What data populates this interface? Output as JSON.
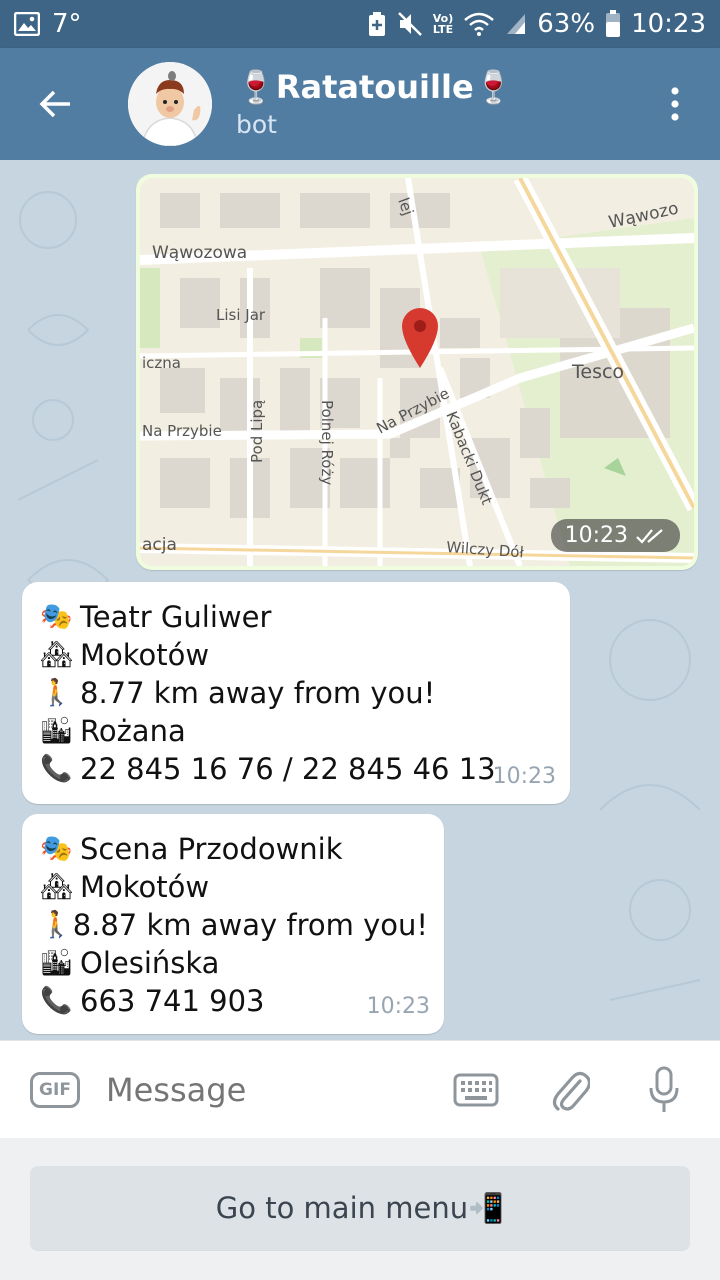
{
  "status_bar": {
    "temperature": "7°",
    "volte_label": "Vo)\nLTE",
    "battery": "63%",
    "time": "10:23"
  },
  "header": {
    "title": "🍷Ratatouille🍷",
    "subtitle": "bot"
  },
  "map_message": {
    "time": "10:23",
    "streets": {
      "s1": "Wąwozowa",
      "s2": "Wąwozo",
      "s3": "Lisi Jar",
      "s4": "iczna",
      "s5": "Tesco",
      "s6": "Na Przybie",
      "s7": "Na Przybie",
      "s8": "Pod Lipą",
      "s9": "Polnej Róży",
      "s10": "Kabacki Dukt",
      "s11": "acja",
      "s12": "Wilczy Dół",
      "s13": "lej"
    }
  },
  "messages": [
    {
      "lines": [
        {
          "emoji": "🎭",
          "text": "Teatr Guliwer"
        },
        {
          "emoji": "🏘",
          "text": "Mokotów"
        },
        {
          "emoji": "🚶",
          "text": "8.77 km away from you!"
        },
        {
          "emoji": "🏙",
          "text": "Rożana"
        },
        {
          "emoji": "📞",
          "text": "22 845 16 76 / 22 845 46 13"
        }
      ],
      "time": "10:23"
    },
    {
      "lines": [
        {
          "emoji": "🎭",
          "text": "Scena Przodownik"
        },
        {
          "emoji": "🏘",
          "text": "Mokotów"
        },
        {
          "emoji": "🚶",
          "text": "8.87 km away from you!"
        },
        {
          "emoji": "🏙",
          "text": "Olesińska"
        },
        {
          "emoji": "📞",
          "text": "663 741 903"
        }
      ],
      "time": "10:23"
    }
  ],
  "input_bar": {
    "gif_label": "GIF",
    "placeholder": "Message"
  },
  "bot_keyboard": {
    "main_menu_label": "Go to main menu📲"
  },
  "colors": {
    "header": "#527da3",
    "status_bar": "#3e6585",
    "outgoing_bubble": "#effdde",
    "incoming_bubble": "#ffffff",
    "chat_background": "#c6d5e0"
  }
}
